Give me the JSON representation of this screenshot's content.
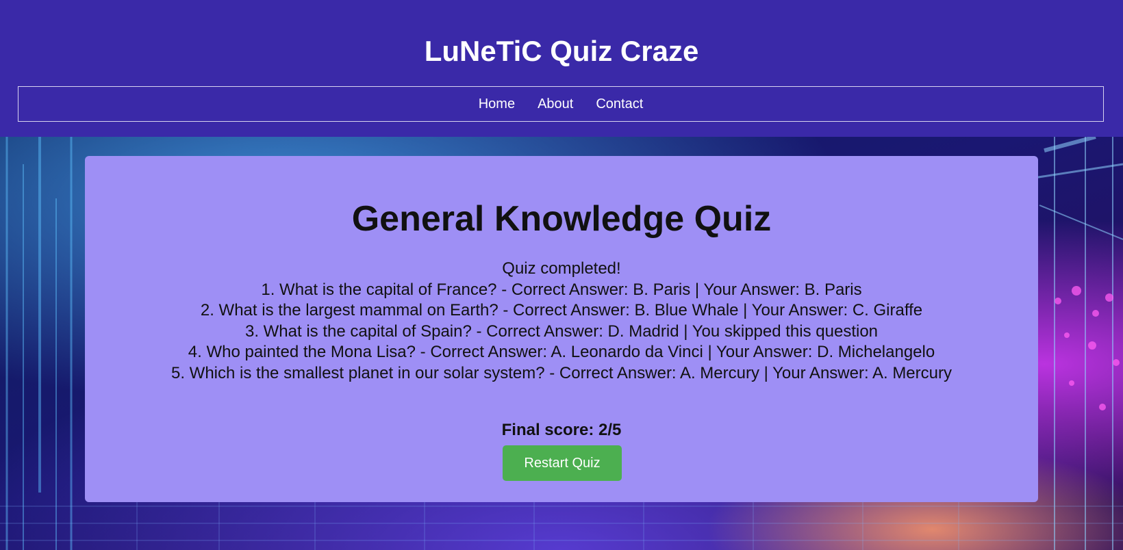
{
  "header": {
    "site_title": "LuNeTiC Quiz Craze",
    "nav": [
      {
        "label": "Home"
      },
      {
        "label": "About"
      },
      {
        "label": "Contact"
      }
    ]
  },
  "quiz": {
    "title": "General Knowledge Quiz",
    "status": "Quiz completed!",
    "results": [
      "1. What is the capital of France? - Correct Answer: B. Paris | Your Answer: B. Paris",
      "2. What is the largest mammal on Earth? - Correct Answer: B. Blue Whale | Your Answer: C. Giraffe",
      "3. What is the capital of Spain? - Correct Answer: D. Madrid | You skipped this question",
      "4. Who painted the Mona Lisa? - Correct Answer: A. Leonardo da Vinci | Your Answer: D. Michelangelo",
      "5. Which is the smallest planet in our solar system? - Correct Answer: A. Mercury | Your Answer: A. Mercury"
    ],
    "final_score": "Final score: 2/5",
    "restart_label": "Restart Quiz"
  },
  "colors": {
    "header_bg": "#3a29a8",
    "card_bg": "#9e8ff5",
    "button_bg": "#4caf50"
  }
}
